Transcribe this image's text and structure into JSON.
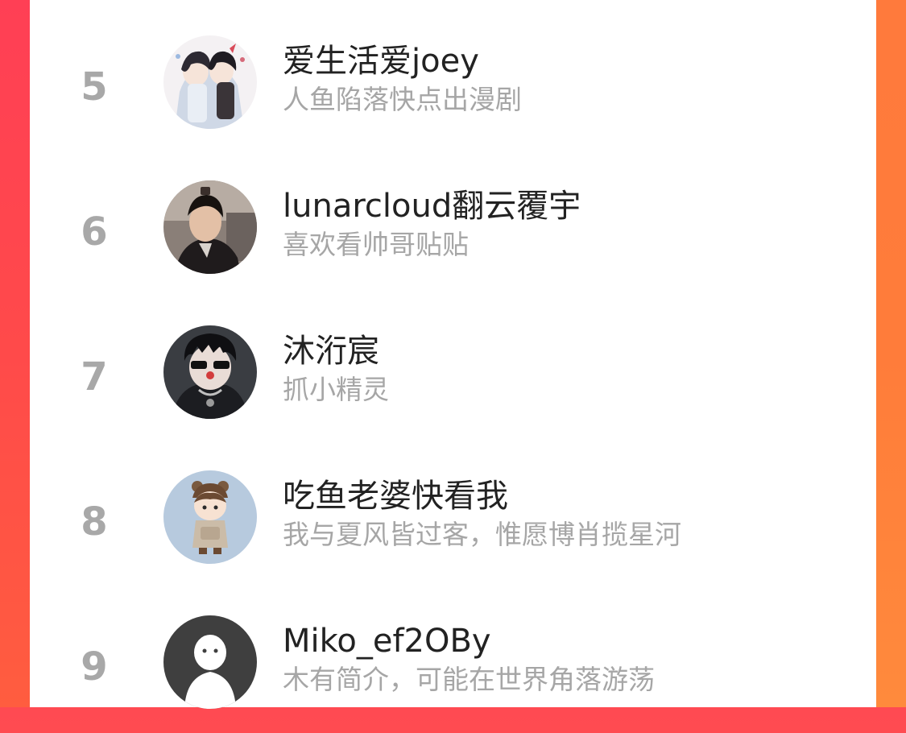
{
  "colors": {
    "card_bg": "#ffffff",
    "rank_color": "#a8a8a8",
    "name_color": "#222222",
    "bio_color": "#a6a6a6",
    "frame_left": "#ff4a4a",
    "frame_right": "#ff7c3a"
  },
  "list": [
    {
      "rank": "5",
      "name": "爱生活爱joey",
      "bio": "人鱼陷落快点出漫剧",
      "avatar": "anime-duo-avatar"
    },
    {
      "rank": "6",
      "name": "lunarcloud翻云覆宇",
      "bio": "喜欢看帅哥贴贴",
      "avatar": "photo-man-avatar"
    },
    {
      "rank": "7",
      "name": "沐洐宸",
      "bio": "抓小精灵",
      "avatar": "dark-figure-avatar"
    },
    {
      "rank": "8",
      "name": "吃鱼老婆快看我",
      "bio": "我与夏风皆过客，惟愿博肖揽星河",
      "avatar": "cartoon-bear-avatar"
    },
    {
      "rank": "9",
      "name": "Miko_ef2OBy",
      "bio": "木有简介，可能在世界角落游荡",
      "avatar": "default-ghost-avatar"
    }
  ]
}
